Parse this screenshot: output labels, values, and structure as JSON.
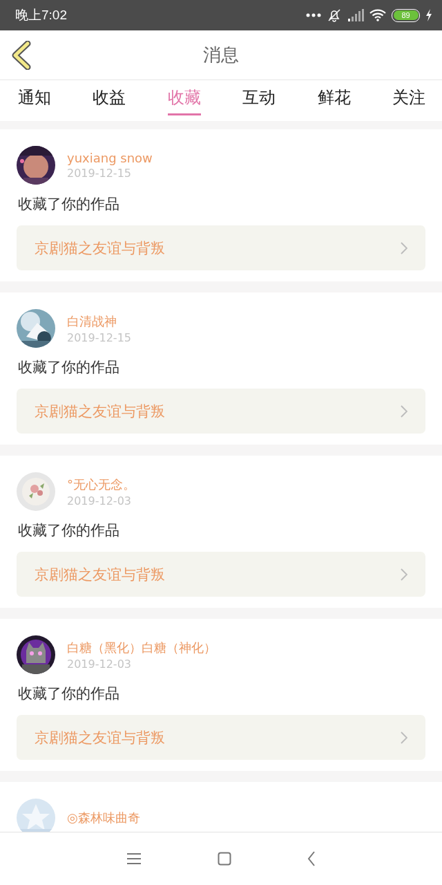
{
  "status_bar": {
    "time": "晚上7:02",
    "battery": "89"
  },
  "header": {
    "title": "消息"
  },
  "tabs": [
    {
      "label": "通知",
      "selected": false
    },
    {
      "label": "收益",
      "selected": false
    },
    {
      "label": "收藏",
      "selected": true
    },
    {
      "label": "互动",
      "selected": false
    },
    {
      "label": "鲜花",
      "selected": false
    },
    {
      "label": "关注",
      "selected": false
    }
  ],
  "messages": [
    {
      "user": "yuxiang snow",
      "date": "2019-12-15",
      "action": "收藏了你的作品",
      "work": "京剧猫之友谊与背叛"
    },
    {
      "user": "白清战神",
      "date": "2019-12-15",
      "action": "收藏了你的作品",
      "work": "京剧猫之友谊与背叛"
    },
    {
      "user": "°无心无念。",
      "date": "2019-12-03",
      "action": "收藏了你的作品",
      "work": "京剧猫之友谊与背叛"
    },
    {
      "user": "白糖（黑化）白糖（神化）",
      "date": "2019-12-03",
      "action": "收藏了你的作品",
      "work": "京剧猫之友谊与背叛"
    },
    {
      "user": "◎森林味曲奇"
    }
  ]
}
